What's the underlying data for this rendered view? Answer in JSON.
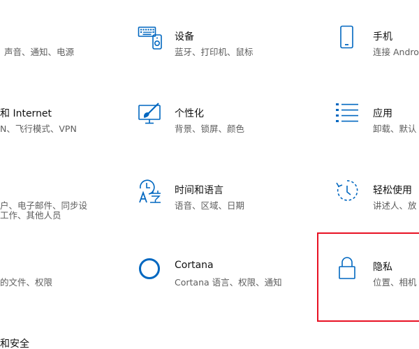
{
  "colors": {
    "accent": "#0067c0",
    "title_text": "#111111",
    "desc_text": "#5d5d5d",
    "highlight": "#e81123"
  },
  "col1": {
    "system": {
      "desc": "声音、通知、电源"
    },
    "network": {
      "title": "和 Internet",
      "desc": "N、飞行模式、VPN"
    },
    "accounts": {
      "desc": "户、电子邮件、同步设",
      "desc2": "工作、其他人员"
    },
    "search": {
      "desc": "的文件、权限"
    },
    "update": {
      "title": "和安全"
    }
  },
  "col2": {
    "devices": {
      "icon": "keyboard-icon",
      "title": "设备",
      "desc": "蓝牙、打印机、鼠标"
    },
    "personalization": {
      "icon": "paint-brush-icon",
      "title": "个性化",
      "desc": "背景、锁屏、颜色"
    },
    "time_language": {
      "icon": "time-language-icon",
      "title": "时间和语言",
      "desc": "语音、区域、日期"
    },
    "cortana": {
      "icon": "cortana-icon",
      "title": "Cortana",
      "desc": "Cortana 语言、权限、通知"
    }
  },
  "col3": {
    "phone": {
      "icon": "phone-icon",
      "title": "手机",
      "desc": "连接 Andro"
    },
    "apps": {
      "icon": "apps-list-icon",
      "title": "应用",
      "desc": "卸载、默认"
    },
    "ease": {
      "icon": "ease-of-access-icon",
      "title": "轻松使用",
      "desc": "讲述人、放"
    },
    "privacy": {
      "icon": "lock-icon",
      "title": "隐私",
      "desc": "位置、相机"
    }
  }
}
